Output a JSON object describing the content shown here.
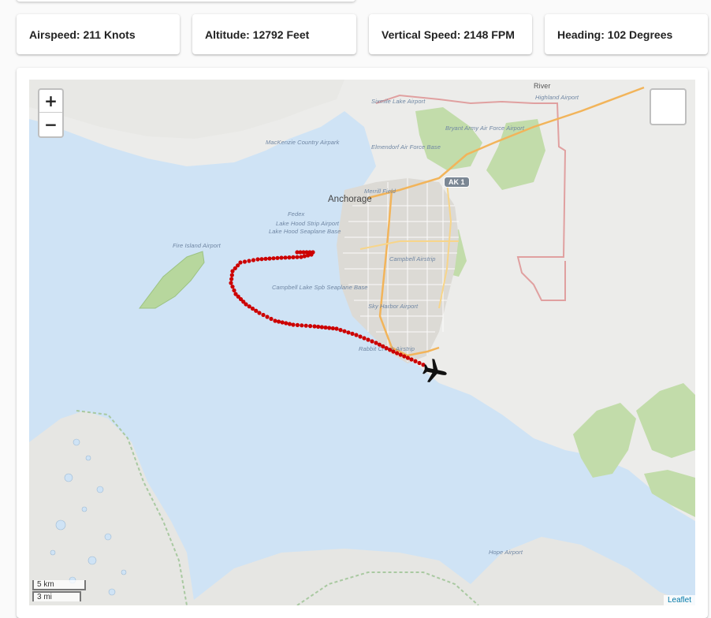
{
  "stats": {
    "airspeed": "Airspeed: 211 Knots",
    "altitude": "Altitude: 12792 Feet",
    "vertical_speed": "Vertical Speed: 2148 FPM",
    "heading": "Heading: 102 Degrees"
  },
  "map": {
    "zoom_in": "+",
    "zoom_out": "−",
    "scale_km": "5 km",
    "scale_mi": "3 mi",
    "attribution": "Leaflet",
    "city": "Anchorage",
    "highway": "AK 1",
    "river_label": "River",
    "labels": {
      "sixmile": "Sixmile Lake Airport",
      "highland": "Highland Airport",
      "bryant": "Bryant Army Air Force Airport",
      "mackenzie": "MacKenzie Country Airpark",
      "elmendorf": "Elmendorf Air Force Base",
      "merrill": "Merrill Field",
      "fedex": "Fedex",
      "lakehood_strip": "Lake Hood Strip Airport",
      "lakehood_seaplane": "Lake Hood Seaplane Base",
      "fire_island": "Fire Island Airport",
      "campbell": "Campbell Airstrip",
      "campbell_lake": "Campbell Lake Spb Seaplane Base",
      "sky_harbor": "Sky Harbor Airport",
      "rabbit_creek": "Rabbit Creek Airstrip",
      "hope": "Hope Airport"
    },
    "track_color": "#cc0000",
    "aircraft_icon": "airplane-icon"
  }
}
